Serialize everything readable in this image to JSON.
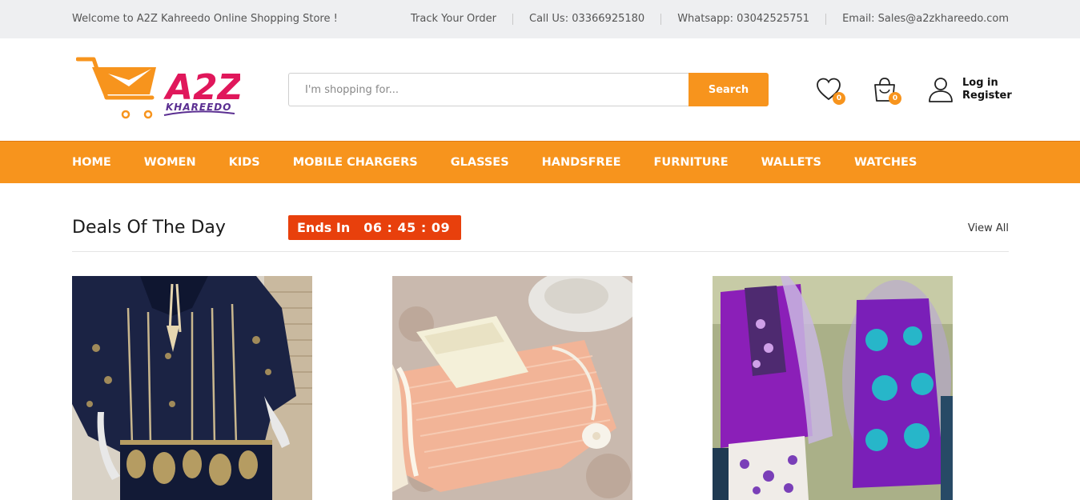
{
  "topbar": {
    "welcome": "Welcome to A2Z Kahreedo Online Shopping Store !",
    "track": "Track Your Order",
    "call": "Call Us: 03366925180",
    "whatsapp": "Whatsapp: 03042525751",
    "email": "Email: Sales@a2zkhareedo.com"
  },
  "brand": {
    "logo_text": "A2Z",
    "logo_sub": "KHAREEDO",
    "accent": "#f7941d",
    "timer_color": "#e8400c"
  },
  "search": {
    "placeholder": "I'm shopping for...",
    "value": "",
    "button": "Search"
  },
  "header_icons": {
    "wishlist": {
      "icon": "heart-icon",
      "count": "0"
    },
    "cart": {
      "icon": "shopping-bag-icon",
      "count": "0"
    },
    "account": {
      "icon": "user-icon",
      "login": "Log in",
      "register": "Register"
    }
  },
  "nav": {
    "items": [
      "HOME",
      "WOMEN",
      "KIDS",
      "MOBILE CHARGERS",
      "GLASSES",
      "HANDSFREE",
      "FURNITURE",
      "WALLETS",
      "WATCHES"
    ]
  },
  "deals": {
    "title": "Deals Of The Day",
    "ends_label": "Ends In",
    "countdown": "06 : 45 : 09",
    "view_all": "View All"
  },
  "products": [
    {
      "image": "navy-striped-embroidered-kurta"
    },
    {
      "image": "peach-frilled-kids-dress"
    },
    {
      "image": "purple-printed-lawn-suit"
    }
  ]
}
